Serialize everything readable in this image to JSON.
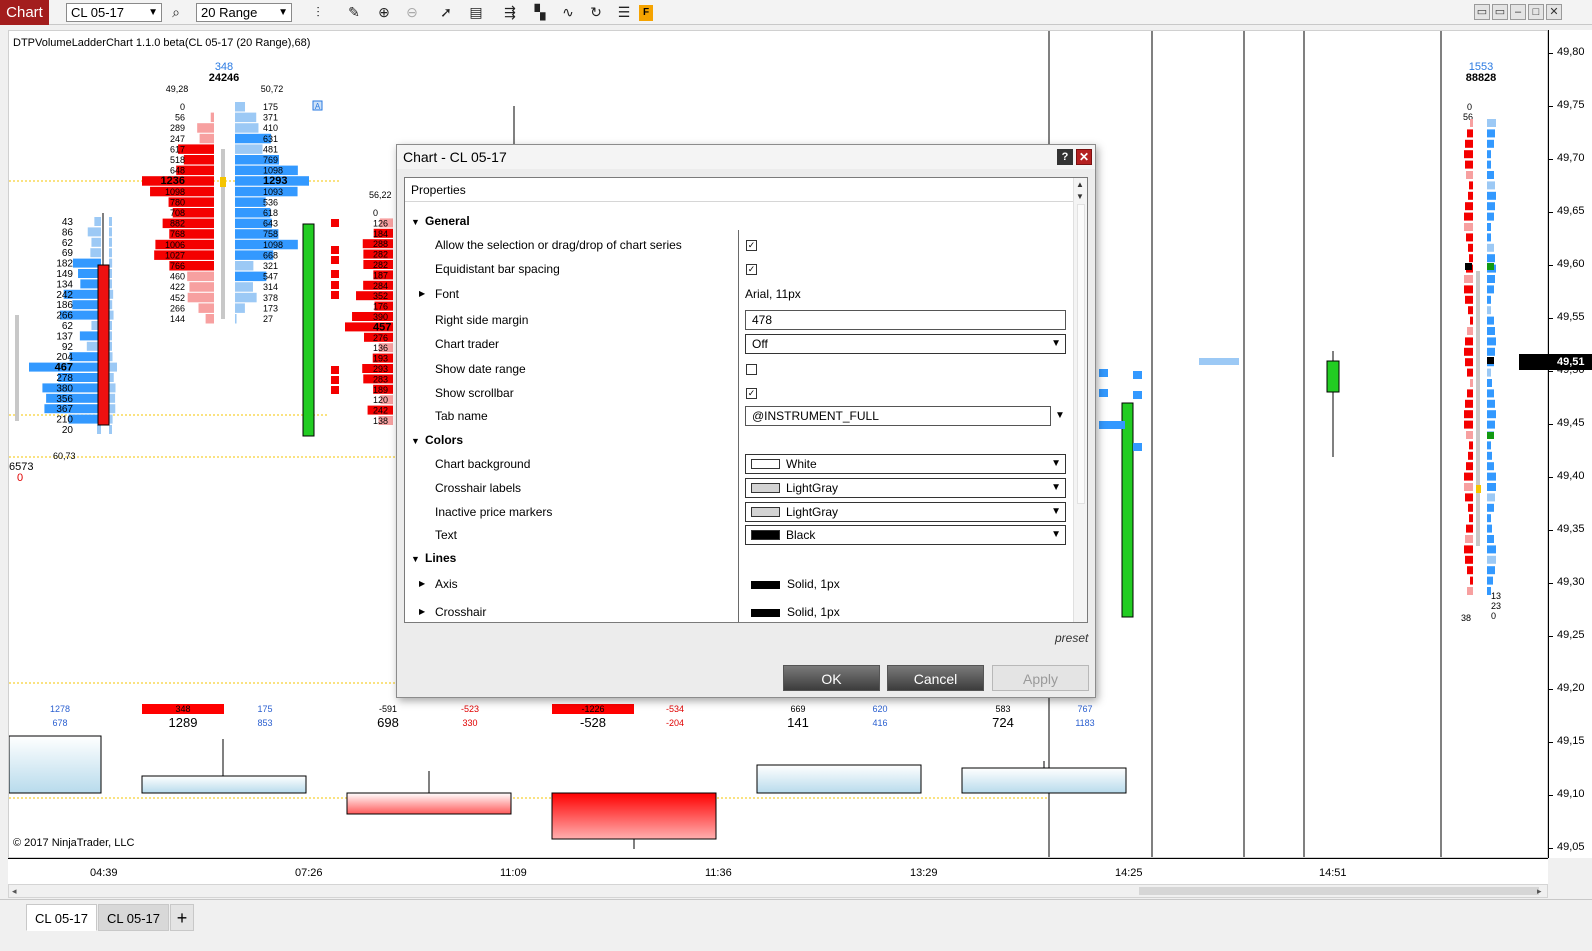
{
  "toolbar": {
    "app_tab": "Chart",
    "instrument": "CL 05-17",
    "bar_type": "20 Range",
    "icons": [
      "bar-type-icon",
      "pencil-icon",
      "zoom-in-icon",
      "zoom-out-icon",
      "pointer-icon",
      "properties-icon",
      "strategies-icon",
      "indicators-icon",
      "drawing-tools-icon",
      "reload-icon",
      "data-box-icon",
      "flatten-icon"
    ],
    "flatten_label": "F"
  },
  "chart": {
    "title": "DTPVolumeLadderChart 1.1.0 beta(CL 05-17 (20 Range),68)",
    "copyright": "© 2017 NinjaTrader, LLC",
    "current_price": "49,51",
    "price_labels": [
      "49,80",
      "49,75",
      "49,70",
      "49,65",
      "49,60",
      "49,55",
      "49,50",
      "49,45",
      "49,40",
      "49,35",
      "49,30",
      "49,25",
      "49,20",
      "49,15",
      "49,10",
      "49,05"
    ],
    "time_labels": [
      "04:39",
      "07:26",
      "11:09",
      "11:36",
      "13:29",
      "14:25",
      "14:51"
    ],
    "colors": {
      "bid": "#3399ff",
      "bid_light": "#9cc9f5",
      "ask": "#f40000",
      "ask_light": "#f7a0a0",
      "up_candle": "#22cc22",
      "down_candle": "#ee1111"
    },
    "ladder1": {
      "left_values": [
        "43",
        "86",
        "62",
        "69",
        "182",
        "149",
        "134",
        "242",
        "186",
        "266",
        "62",
        "137",
        "92",
        "204",
        "467",
        "278",
        "380",
        "356",
        "367",
        "210",
        "20"
      ],
      "bottom_label": "60,73",
      "side_total": "6573",
      "side_delta": "0"
    },
    "ladder2": {
      "delta": "348",
      "volume": "24246",
      "high_left": "49,28",
      "high_right": "50,72",
      "ask_values": [
        "0",
        "56",
        "289",
        "247",
        "617",
        "518",
        "648",
        "1236",
        "1098",
        "780",
        "708",
        "882",
        "768",
        "1006",
        "1027",
        "766",
        "460",
        "422",
        "452",
        "266",
        "144"
      ],
      "bid_values": [
        "175",
        "371",
        "410",
        "631",
        "481",
        "769",
        "1098",
        "1293",
        "1093",
        "536",
        "618",
        "643",
        "758",
        "1098",
        "668",
        "321",
        "547",
        "314",
        "378",
        "173",
        "27"
      ],
      "box_label": "A"
    },
    "ladder3": {
      "top_label": "56,22",
      "values": [
        "0",
        "126",
        "184",
        "288",
        "282",
        "282",
        "187",
        "284",
        "352",
        "176",
        "390",
        "457",
        "276",
        "136",
        "193",
        "293",
        "283",
        "189",
        "120",
        "242",
        "138"
      ]
    },
    "ladder_right": {
      "delta": "1553",
      "volume": "88828",
      "top_values": [
        "0",
        "56"
      ],
      "bottom_left": "38",
      "bottom_right": [
        "13",
        "23",
        "0"
      ]
    },
    "delta_panel": [
      {
        "top": "1278",
        "bottom": "678"
      },
      {
        "top": "348",
        "big": "1289",
        "highlight": true
      },
      {
        "top": "175",
        "bottom": "853"
      },
      {
        "top": "-591",
        "big": "698"
      },
      {
        "top": "-523",
        "bottom": "330",
        "red": true
      },
      {
        "top": "-1226",
        "big": "-528",
        "highlight": true
      },
      {
        "top": "-534",
        "bottom": "-204",
        "red": true
      },
      {
        "top": "669",
        "big": "141"
      },
      {
        "top": "620",
        "bottom": "416"
      },
      {
        "top": "583",
        "big": "724"
      },
      {
        "top": "767",
        "bottom": "1183"
      }
    ]
  },
  "tabs": [
    {
      "label": "CL 05-17",
      "active": true
    },
    {
      "label": "CL 05-17",
      "active": false
    }
  ],
  "add_tab": "+",
  "dialog": {
    "title": "Chart - CL 05-17",
    "help": "?",
    "close": "✕",
    "properties_header": "Properties",
    "categories": {
      "general": "General",
      "colors": "Colors",
      "lines": "Lines"
    },
    "general": {
      "allow_selection": {
        "label": "Allow the selection or drag/drop of chart series",
        "checked": true
      },
      "equidistant": {
        "label": "Equidistant bar spacing",
        "checked": true
      },
      "font": {
        "label": "Font",
        "value": "Arial, 11px"
      },
      "right_margin": {
        "label": "Right side margin",
        "value": "478"
      },
      "chart_trader": {
        "label": "Chart trader",
        "value": "Off"
      },
      "show_date_range": {
        "label": "Show date range",
        "checked": false
      },
      "show_scrollbar": {
        "label": "Show scrollbar",
        "checked": true
      },
      "tab_name": {
        "label": "Tab name",
        "value": "@INSTRUMENT_FULL"
      }
    },
    "colors": {
      "chart_background": {
        "label": "Chart background",
        "value": "White",
        "swatch": "#ffffff"
      },
      "crosshair_labels": {
        "label": "Crosshair labels",
        "value": "LightGray",
        "swatch": "#d3d3d3"
      },
      "inactive_price_markers": {
        "label": "Inactive price markers",
        "value": "LightGray",
        "swatch": "#d3d3d3"
      },
      "text": {
        "label": "Text",
        "value": "Black",
        "swatch": "#000000"
      }
    },
    "lines": {
      "axis": {
        "label": "Axis",
        "value": "Solid, 1px"
      },
      "crosshair": {
        "label": "Crosshair",
        "value": "Solid, 1px"
      }
    },
    "preset": "preset",
    "buttons": {
      "ok": "OK",
      "cancel": "Cancel",
      "apply": "Apply"
    }
  }
}
